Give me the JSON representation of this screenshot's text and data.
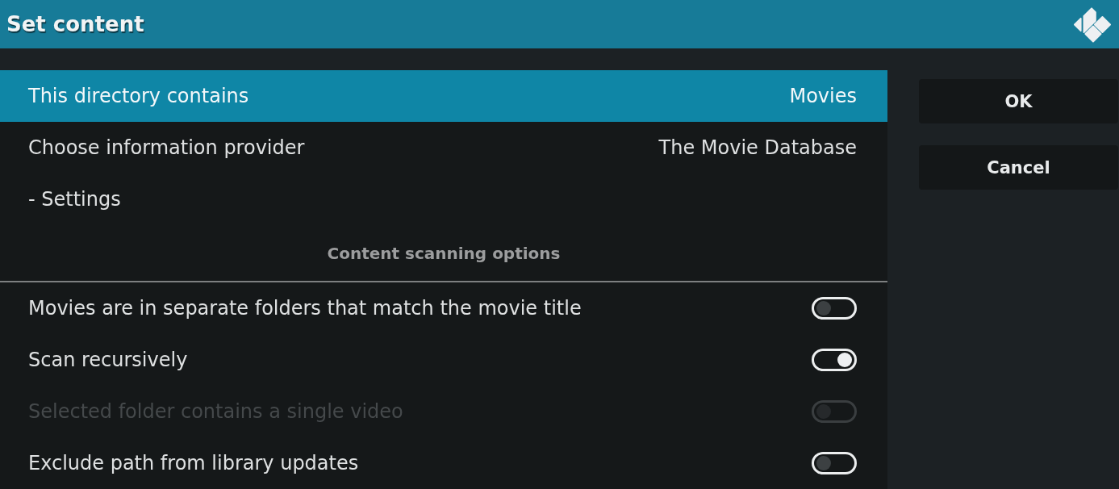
{
  "window": {
    "title": "Set content"
  },
  "settings": [
    {
      "kind": "value",
      "label": "This directory contains",
      "value": "Movies",
      "selected": true,
      "disabled": false
    },
    {
      "kind": "value",
      "label": "Choose information provider",
      "value": "The Movie Database",
      "selected": false,
      "disabled": false
    },
    {
      "kind": "action",
      "label": "- Settings",
      "selected": false,
      "disabled": false
    },
    {
      "kind": "heading",
      "label": "Content scanning options"
    },
    {
      "kind": "toggle",
      "label": "Movies are in separate folders that match the movie title",
      "on": false,
      "selected": false,
      "disabled": false
    },
    {
      "kind": "toggle",
      "label": "Scan recursively",
      "on": true,
      "selected": false,
      "disabled": false
    },
    {
      "kind": "toggle",
      "label": "Selected folder contains a single video",
      "on": false,
      "selected": false,
      "disabled": true
    },
    {
      "kind": "toggle",
      "label": "Exclude path from library updates",
      "on": false,
      "selected": false,
      "disabled": false
    }
  ],
  "buttons": [
    {
      "label": "OK"
    },
    {
      "label": "Cancel"
    }
  ]
}
